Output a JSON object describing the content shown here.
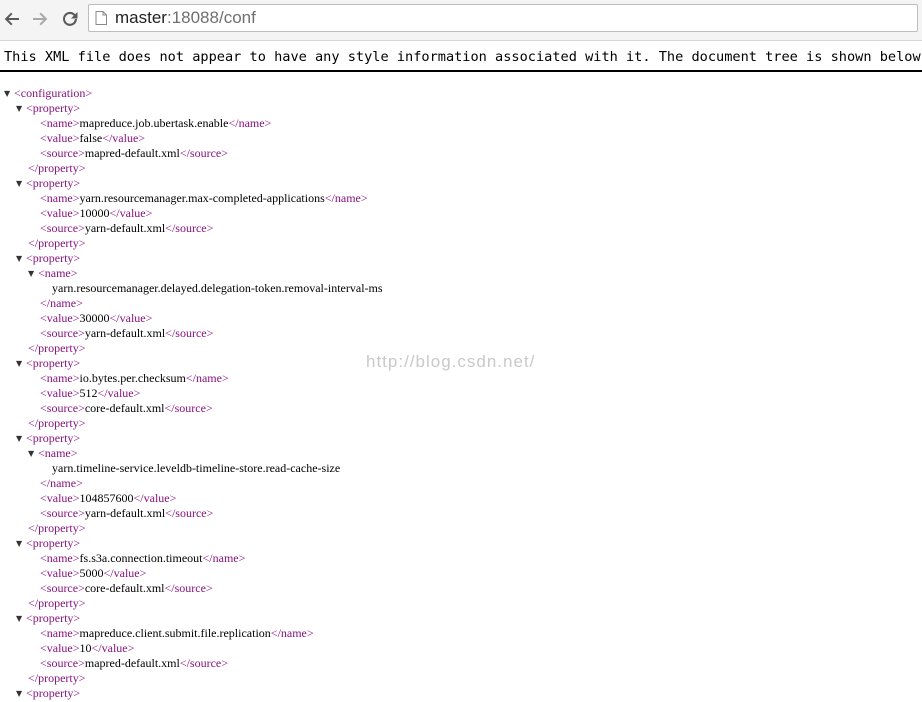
{
  "browser": {
    "url_host": "master",
    "url_rest": ":18088/conf",
    "icons": {
      "back": "back-arrow-icon",
      "forward": "forward-arrow-icon",
      "reload": "reload-icon",
      "page": "page-icon"
    }
  },
  "xml_info": "This XML file does not appear to have any style information associated with it. The document tree is shown below.",
  "watermark": "http://blog.csdn.net/",
  "tags": {
    "configuration_open": "<configuration>",
    "property_open": "<property>",
    "property_close": "</property>",
    "name_open": "<name>",
    "name_close": "</name>",
    "value_open": "<value>",
    "value_close": "</value>",
    "source_open": "<source>",
    "source_close": "</source>"
  },
  "properties": [
    {
      "name": "mapreduce.job.ubertask.enable",
      "value": "false",
      "source": "mapred-default.xml"
    },
    {
      "name": "yarn.resourcemanager.max-completed-applications",
      "value": "10000",
      "source": "yarn-default.xml"
    },
    {
      "name": "yarn.resourcemanager.delayed.delegation-token.removal-interval-ms",
      "value": "30000",
      "source": "yarn-default.xml"
    },
    {
      "name": "io.bytes.per.checksum",
      "value": "512",
      "source": "core-default.xml"
    },
    {
      "name": "yarn.timeline-service.leveldb-timeline-store.read-cache-size",
      "value": "104857600",
      "source": "yarn-default.xml"
    },
    {
      "name": "fs.s3a.connection.timeout",
      "value": "5000",
      "source": "core-default.xml"
    },
    {
      "name": "mapreduce.client.submit.file.replication",
      "value": "10",
      "source": "mapred-default.xml"
    }
  ]
}
